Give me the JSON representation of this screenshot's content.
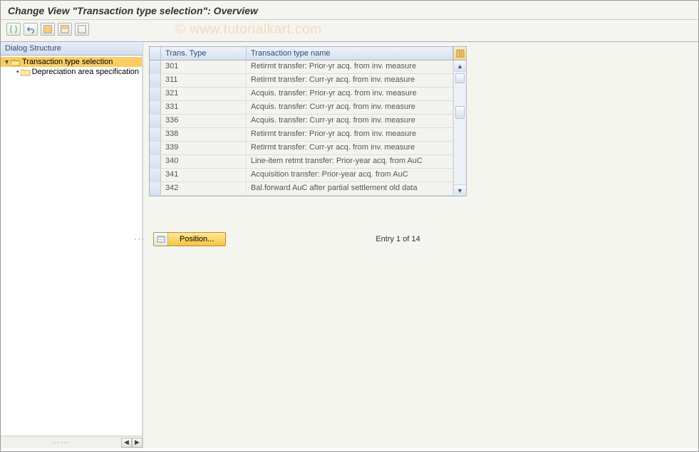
{
  "page_title": "Change View \"Transaction type selection\": Overview",
  "watermark": "© www.tutorialkart.com",
  "sidebar": {
    "header": "Dialog Structure",
    "items": [
      {
        "label": "Transaction type selection",
        "selected": true,
        "expandable": true
      },
      {
        "label": "Depreciation area specification",
        "selected": false,
        "expandable": false
      }
    ]
  },
  "grid": {
    "col_type": "Trans. Type",
    "col_name": "Transaction type name",
    "rows": [
      {
        "type": "301",
        "name": "Retirmt transfer: Prior-yr acq. from inv. measure"
      },
      {
        "type": "311",
        "name": "Retirmt transfer: Curr-yr acq. from inv. measure"
      },
      {
        "type": "321",
        "name": "Acquis. transfer: Prior-yr acq. from inv. measure"
      },
      {
        "type": "331",
        "name": "Acquis. transfer: Curr-yr acq. from inv. measure"
      },
      {
        "type": "336",
        "name": "Acquis. transfer: Curr-yr acq. from inv. measure"
      },
      {
        "type": "338",
        "name": "Retirmt transfer: Prior-yr acq. from inv. measure"
      },
      {
        "type": "339",
        "name": "Retirmt transfer: Curr-yr acq. from inv. measure"
      },
      {
        "type": "340",
        "name": "Line-item retmt transfer: Prior-year acq. from AuC"
      },
      {
        "type": "341",
        "name": "Acquisition transfer: Prior-year acq. from AuC"
      },
      {
        "type": "342",
        "name": "Bal.forward AuC after partial settlement old data"
      }
    ]
  },
  "footer": {
    "position_label": "Position...",
    "entry_label": "Entry 1 of 14"
  }
}
